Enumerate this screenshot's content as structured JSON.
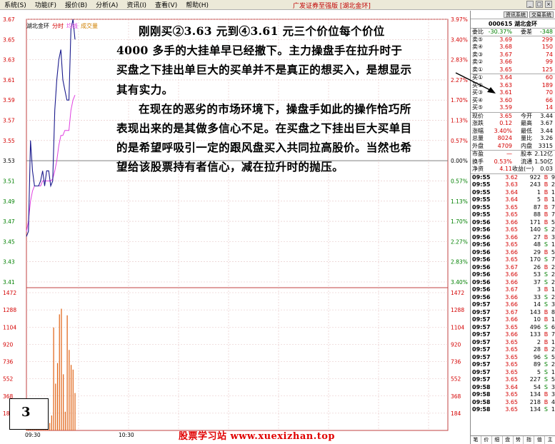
{
  "menu": {
    "items": [
      "系统(S)",
      "功能(F)",
      "报价(B)",
      "分析(A)",
      "资讯(I)",
      "查看(V)",
      "帮助(H)"
    ],
    "app_title": "广发证券至强版 [湖北金环]"
  },
  "chart": {
    "stock_label": "湖北金环",
    "legend": [
      "分时",
      "均线",
      "成交量"
    ],
    "left_axis": [
      "3.67",
      "3.65",
      "3.63",
      "3.61",
      "3.59",
      "3.57",
      "3.55",
      "3.53",
      "3.51",
      "3.49",
      "3.47",
      "3.45",
      "3.43",
      "3.41"
    ],
    "right_axis": [
      "3.97%",
      "3.40%",
      "2.83%",
      "2.27%",
      "1.70%",
      "1.13%",
      "0.57%",
      "0.00%",
      "0.57%",
      "1.13%",
      "1.70%",
      "2.27%",
      "2.83%",
      "3.40%"
    ],
    "vol_axis_left": [
      "1472",
      "1288",
      "1104",
      "920",
      "736",
      "552",
      "368",
      "184"
    ],
    "vol_axis_right": [
      "1472",
      "1288",
      "1104",
      "920",
      "736",
      "552",
      "368",
      "184"
    ],
    "time_labels": [
      "09:30",
      "10:30"
    ],
    "price_line": [
      3.455,
      3.46,
      3.55,
      3.52,
      3.505,
      3.505,
      3.505,
      3.51,
      3.52,
      3.505,
      3.52,
      3.52,
      3.505,
      3.51,
      3.58,
      3.61,
      3.63,
      3.64,
      3.61,
      3.6,
      3.59,
      3.59,
      3.66,
      3.67,
      3.65
    ],
    "avg_line": [
      3.46,
      3.47,
      3.49,
      3.5,
      3.505,
      3.505,
      3.505,
      3.505,
      3.51,
      3.51,
      3.51,
      3.51,
      3.51,
      3.512,
      3.52,
      3.53,
      3.545,
      3.555,
      3.555,
      3.56,
      3.56,
      3.56,
      3.58,
      3.59,
      3.595
    ],
    "volumes": [
      60,
      30,
      40,
      320,
      80,
      120,
      90,
      150,
      60,
      70,
      40,
      90,
      80,
      160,
      1100,
      500,
      720,
      1240,
      1300,
      600,
      200,
      1230,
      860,
      700,
      650,
      400
    ]
  },
  "overlay": {
    "p1": "刚刚买②3.63 元到④3.61 元三个价位每个价位 4000 多手的大挂单早已经撤下。主力操盘手在拉升时于买盘之下挂出单巨大的买单并不是真正的想买入，是想显示其有实力。",
    "p2": "在现在的恶劣的市场环境下，操盘手如此的操作恰巧所表现出来的是其做多信心不足。在买盘之下挂出巨大买单目的是希望呼吸引一定的跟风盘买入共同拉高股价。当然也希望给该股票持有者信心，减在拉升时的抛压。"
  },
  "page_number": "3",
  "footer": "股票学习站   www.xuexizhan.top",
  "panel": {
    "tabs": [
      "资讯系统",
      "交易系统"
    ],
    "code": "000615",
    "name": "湖北金环",
    "weibi": {
      "label": "委比",
      "value": "-30.37%",
      "label2": "委差",
      "value2": "-348"
    },
    "sells": [
      {
        "label": "卖⑤",
        "price": "3.69",
        "vol": "299"
      },
      {
        "label": "卖④",
        "price": "3.68",
        "vol": "150"
      },
      {
        "label": "卖③",
        "price": "3.67",
        "vol": "74"
      },
      {
        "label": "卖②",
        "price": "3.66",
        "vol": "99"
      },
      {
        "label": "卖①",
        "price": "3.65",
        "vol": "125"
      }
    ],
    "buys": [
      {
        "label": "买①",
        "price": "3.64",
        "vol": "60"
      },
      {
        "label": "买②",
        "price": "3.63",
        "vol": "189"
      },
      {
        "label": "买③",
        "price": "3.61",
        "vol": "70"
      },
      {
        "label": "买④",
        "price": "3.60",
        "vol": "66"
      },
      {
        "label": "买⑤",
        "price": "3.59",
        "vol": "14"
      }
    ],
    "stats": [
      {
        "l1": "现价",
        "v1": "3.65",
        "l2": "今开",
        "v2": "3.44"
      },
      {
        "l1": "涨跌",
        "v1": "0.12",
        "l2": "最高",
        "v2": "3.67"
      },
      {
        "l1": "涨幅",
        "v1": "3.40%",
        "l2": "最低",
        "v2": "3.44"
      },
      {
        "l1": "总量",
        "v1": "8024",
        "l2": "量比",
        "v2": "3.26"
      },
      {
        "l1": "外盘",
        "v1": "4709",
        "l2": "内盘",
        "v2": "3315"
      }
    ],
    "stats2": [
      {
        "l1": "市盈",
        "v1": "—",
        "l2": "股本",
        "v2": "2.12亿"
      },
      {
        "l1": "换手",
        "v1": "0.53%",
        "l2": "流通",
        "v2": "1.50亿"
      },
      {
        "l1": "净资",
        "v1": "4.11",
        "l2": "收益(一)",
        "v2": "0.03"
      }
    ],
    "ticks": [
      {
        "t": "09:55",
        "p": "3.62",
        "v": "922",
        "f": "B",
        "n": "9"
      },
      {
        "t": "09:55",
        "p": "3.63",
        "v": "243",
        "f": "B",
        "n": "2"
      },
      {
        "t": "09:55",
        "p": "3.64",
        "v": "1",
        "f": "B",
        "n": "1"
      },
      {
        "t": "09:55",
        "p": "3.64",
        "v": "5",
        "f": "B",
        "n": "1"
      },
      {
        "t": "09:55",
        "p": "3.65",
        "v": "87",
        "f": "B",
        "n": "7"
      },
      {
        "t": "09:55",
        "p": "3.65",
        "v": "88",
        "f": "B",
        "n": "7"
      },
      {
        "t": "09:56",
        "p": "3.66",
        "v": "171",
        "f": "B",
        "n": "5"
      },
      {
        "t": "09:56",
        "p": "3.65",
        "v": "140",
        "f": "S",
        "n": "2"
      },
      {
        "t": "09:56",
        "p": "3.66",
        "v": "27",
        "f": "B",
        "n": "3"
      },
      {
        "t": "09:56",
        "p": "3.65",
        "v": "48",
        "f": "S",
        "n": "1"
      },
      {
        "t": "09:56",
        "p": "3.66",
        "v": "29",
        "f": "B",
        "n": "5"
      },
      {
        "t": "09:56",
        "p": "3.65",
        "v": "170",
        "f": "S",
        "n": "7"
      },
      {
        "t": "09:56",
        "p": "3.67",
        "v": "26",
        "f": "B",
        "n": "2"
      },
      {
        "t": "09:56",
        "p": "3.66",
        "v": "53",
        "f": "S",
        "n": "2"
      },
      {
        "t": "09:56",
        "p": "3.66",
        "v": "37",
        "f": "S",
        "n": "2"
      },
      {
        "t": "09:56",
        "p": "3.67",
        "v": "3",
        "f": "B",
        "n": "1"
      },
      {
        "t": "09:56",
        "p": "3.66",
        "v": "33",
        "f": "S",
        "n": "2"
      },
      {
        "t": "09:57",
        "p": "3.66",
        "v": "14",
        "f": "S",
        "n": "3"
      },
      {
        "t": "09:57",
        "p": "3.67",
        "v": "143",
        "f": "B",
        "n": "8"
      },
      {
        "t": "09:57",
        "p": "3.66",
        "v": "10",
        "f": "B",
        "n": "1"
      },
      {
        "t": "09:57",
        "p": "3.65",
        "v": "496",
        "f": "S",
        "n": "6"
      },
      {
        "t": "09:57",
        "p": "3.66",
        "v": "133",
        "f": "B",
        "n": "7"
      },
      {
        "t": "09:57",
        "p": "3.65",
        "v": "2",
        "f": "B",
        "n": "1"
      },
      {
        "t": "09:57",
        "p": "3.65",
        "v": "28",
        "f": "B",
        "n": "2"
      },
      {
        "t": "09:57",
        "p": "3.65",
        "v": "96",
        "f": "S",
        "n": "5"
      },
      {
        "t": "09:57",
        "p": "3.65",
        "v": "89",
        "f": "S",
        "n": "2"
      },
      {
        "t": "09:57",
        "p": "3.65",
        "v": "5",
        "f": "S",
        "n": "1"
      },
      {
        "t": "09:57",
        "p": "3.65",
        "v": "227",
        "f": "S",
        "n": "5"
      },
      {
        "t": "09:58",
        "p": "3.64",
        "v": "54",
        "f": "S",
        "n": "3"
      },
      {
        "t": "09:58",
        "p": "3.65",
        "v": "134",
        "f": "B",
        "n": "3"
      },
      {
        "t": "09:58",
        "p": "3.65",
        "v": "218",
        "f": "B",
        "n": "4"
      },
      {
        "t": "09:58",
        "p": "3.65",
        "v": "134",
        "f": "S",
        "n": "1"
      }
    ],
    "bottom_tabs": [
      "笔",
      "价",
      "细",
      "盘",
      "势",
      "指",
      "值",
      "主"
    ]
  },
  "colors": {
    "red": "#d40000",
    "green": "#008000",
    "price_line": "#1a1a8c",
    "avg_line": "#e040e0",
    "vol": "#e06010"
  }
}
